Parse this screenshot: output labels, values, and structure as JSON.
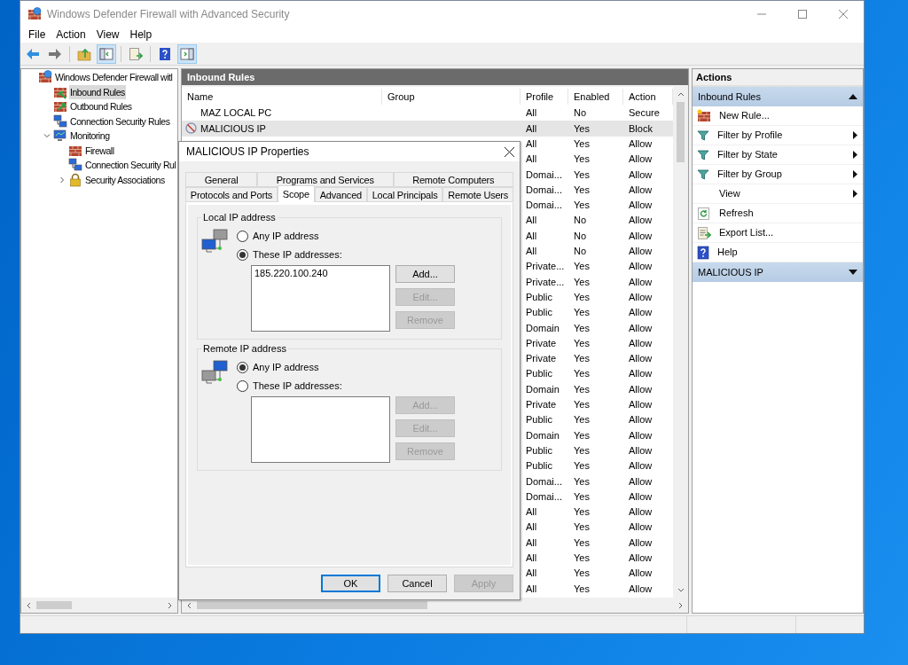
{
  "window": {
    "title": "Windows Defender Firewall with Advanced Security"
  },
  "menu": [
    "File",
    "Action",
    "View",
    "Help"
  ],
  "toolbar": [
    [
      {
        "kind": "back",
        "on": false
      },
      {
        "kind": "forward",
        "on": false
      }
    ],
    [
      {
        "kind": "up",
        "on": false
      },
      {
        "kind": "tree",
        "on": true
      }
    ],
    [
      {
        "kind": "export",
        "on": false
      }
    ],
    [
      {
        "kind": "help",
        "on": false
      },
      {
        "kind": "pane",
        "on": true
      }
    ]
  ],
  "tree": [
    {
      "label": "Windows Defender Firewall witl",
      "kind": "firewall-globe",
      "selected": false,
      "children": [
        {
          "label": "Inbound Rules",
          "kind": "inbound",
          "selected": true
        },
        {
          "label": "Outbound Rules",
          "kind": "outbound",
          "selected": false
        },
        {
          "label": "Connection Security Rules",
          "kind": "connection",
          "selected": false
        },
        {
          "label": "Monitoring",
          "kind": "monitoring",
          "selected": false,
          "expanded": true,
          "children": [
            {
              "label": "Firewall",
              "kind": "firewall",
              "selected": false
            },
            {
              "label": "Connection Security Rul",
              "kind": "connection",
              "selected": false
            },
            {
              "label": "Security Associations",
              "kind": "lock",
              "selected": false,
              "expanded": false
            }
          ]
        }
      ]
    }
  ],
  "rules": {
    "title": "Inbound Rules",
    "columns": [
      "Name",
      "Group",
      "Profile",
      "Enabled",
      "Action"
    ],
    "rows": [
      {
        "name": "MAZ LOCAL PC",
        "kind": "none",
        "profile": "All",
        "enabled": "No",
        "action": "Secure",
        "selected": false
      },
      {
        "name": "MALICIOUS IP",
        "kind": "block",
        "profile": "All",
        "enabled": "Yes",
        "action": "Block",
        "selected": true
      },
      {
        "profile": "All",
        "enabled": "Yes",
        "action": "Allow",
        "selected": false
      },
      {
        "profile": "All",
        "enabled": "Yes",
        "action": "Allow",
        "selected": false
      },
      {
        "profile": "Domai...",
        "enabled": "Yes",
        "action": "Allow",
        "selected": false
      },
      {
        "profile": "Domai...",
        "enabled": "Yes",
        "action": "Allow",
        "selected": false
      },
      {
        "profile": "Domai...",
        "enabled": "Yes",
        "action": "Allow",
        "selected": false
      },
      {
        "profile": "All",
        "enabled": "No",
        "action": "Allow",
        "selected": false
      },
      {
        "profile": "All",
        "enabled": "No",
        "action": "Allow",
        "selected": false
      },
      {
        "profile": "All",
        "enabled": "No",
        "action": "Allow",
        "selected": false
      },
      {
        "profile": "Private...",
        "enabled": "Yes",
        "action": "Allow",
        "selected": false
      },
      {
        "profile": "Private...",
        "enabled": "Yes",
        "action": "Allow",
        "selected": false
      },
      {
        "profile": "Public",
        "enabled": "Yes",
        "action": "Allow",
        "selected": false
      },
      {
        "profile": "Public",
        "enabled": "Yes",
        "action": "Allow",
        "selected": false
      },
      {
        "profile": "Domain",
        "enabled": "Yes",
        "action": "Allow",
        "selected": false
      },
      {
        "profile": "Private",
        "enabled": "Yes",
        "action": "Allow",
        "selected": false
      },
      {
        "profile": "Private",
        "enabled": "Yes",
        "action": "Allow",
        "selected": false
      },
      {
        "profile": "Public",
        "enabled": "Yes",
        "action": "Allow",
        "selected": false
      },
      {
        "profile": "Domain",
        "enabled": "Yes",
        "action": "Allow",
        "selected": false
      },
      {
        "profile": "Private",
        "enabled": "Yes",
        "action": "Allow",
        "selected": false
      },
      {
        "profile": "Public",
        "enabled": "Yes",
        "action": "Allow",
        "selected": false
      },
      {
        "profile": "Domain",
        "enabled": "Yes",
        "action": "Allow",
        "selected": false
      },
      {
        "profile": "Public",
        "enabled": "Yes",
        "action": "Allow",
        "selected": false
      },
      {
        "profile": "Public",
        "enabled": "Yes",
        "action": "Allow",
        "selected": false
      },
      {
        "profile": "Domai...",
        "enabled": "Yes",
        "action": "Allow",
        "selected": false
      },
      {
        "profile": "Domai...",
        "enabled": "Yes",
        "action": "Allow",
        "selected": false
      },
      {
        "profile": "All",
        "enabled": "Yes",
        "action": "Allow",
        "selected": false
      },
      {
        "profile": "All",
        "enabled": "Yes",
        "action": "Allow",
        "selected": false
      },
      {
        "profile": "All",
        "enabled": "Yes",
        "action": "Allow",
        "selected": false
      },
      {
        "profile": "All",
        "enabled": "Yes",
        "action": "Allow",
        "selected": false
      },
      {
        "profile": "All",
        "enabled": "Yes",
        "action": "Allow",
        "selected": false
      },
      {
        "profile": "All",
        "enabled": "Yes",
        "action": "Allow",
        "selected": false
      }
    ]
  },
  "actions": {
    "title": "Actions",
    "sections": [
      {
        "title": "Inbound Rules",
        "expanded": true,
        "items": [
          {
            "label": "New Rule...",
            "kind": "new-rule",
            "submenu": false
          },
          {
            "label": "Filter by Profile",
            "kind": "filter",
            "submenu": true
          },
          {
            "label": "Filter by State",
            "kind": "filter",
            "submenu": true
          },
          {
            "label": "Filter by Group",
            "kind": "filter",
            "submenu": true
          },
          {
            "label": "View",
            "kind": "none",
            "submenu": true
          },
          {
            "label": "Refresh",
            "kind": "refresh",
            "submenu": false
          },
          {
            "label": "Export List...",
            "kind": "export",
            "submenu": false
          },
          {
            "label": "Help",
            "kind": "help",
            "submenu": false
          }
        ]
      },
      {
        "title": "MALICIOUS IP",
        "expanded": false
      }
    ]
  },
  "dialog": {
    "title": "MALICIOUS IP Properties",
    "tab_rows": [
      [
        {
          "label": "General",
          "selected": false
        },
        {
          "label": "Programs and Services",
          "selected": false
        },
        {
          "label": "Remote Computers",
          "selected": false
        }
      ],
      [
        {
          "label": "Protocols and Ports",
          "selected": false
        },
        {
          "label": "Scope",
          "selected": true
        },
        {
          "label": "Advanced",
          "selected": false
        },
        {
          "label": "Local Principals",
          "selected": false
        },
        {
          "label": "Remote Users",
          "selected": false
        }
      ]
    ],
    "groups": [
      {
        "title": "Local IP address",
        "kind": "local",
        "options": [
          {
            "label": "Any IP address",
            "selected": false
          },
          {
            "label": "These IP addresses:",
            "selected": true
          }
        ],
        "addresses": [
          "185.220.100.240"
        ],
        "buttons": [
          {
            "label": "Add...",
            "disabled": false
          },
          {
            "label": "Edit...",
            "disabled": true
          },
          {
            "label": "Remove",
            "disabled": true
          }
        ]
      },
      {
        "title": "Remote IP address",
        "kind": "remote",
        "options": [
          {
            "label": "Any IP address",
            "selected": true
          },
          {
            "label": "These IP addresses:",
            "selected": false
          }
        ],
        "buttons": [
          {
            "label": "Add...",
            "disabled": true
          },
          {
            "label": "Edit...",
            "disabled": true
          },
          {
            "label": "Remove",
            "disabled": true
          }
        ]
      }
    ],
    "buttons": [
      {
        "label": "OK",
        "default": true,
        "disabled": false
      },
      {
        "label": "Cancel",
        "default": false,
        "disabled": false
      },
      {
        "label": "Apply",
        "default": false,
        "disabled": true
      }
    ]
  }
}
